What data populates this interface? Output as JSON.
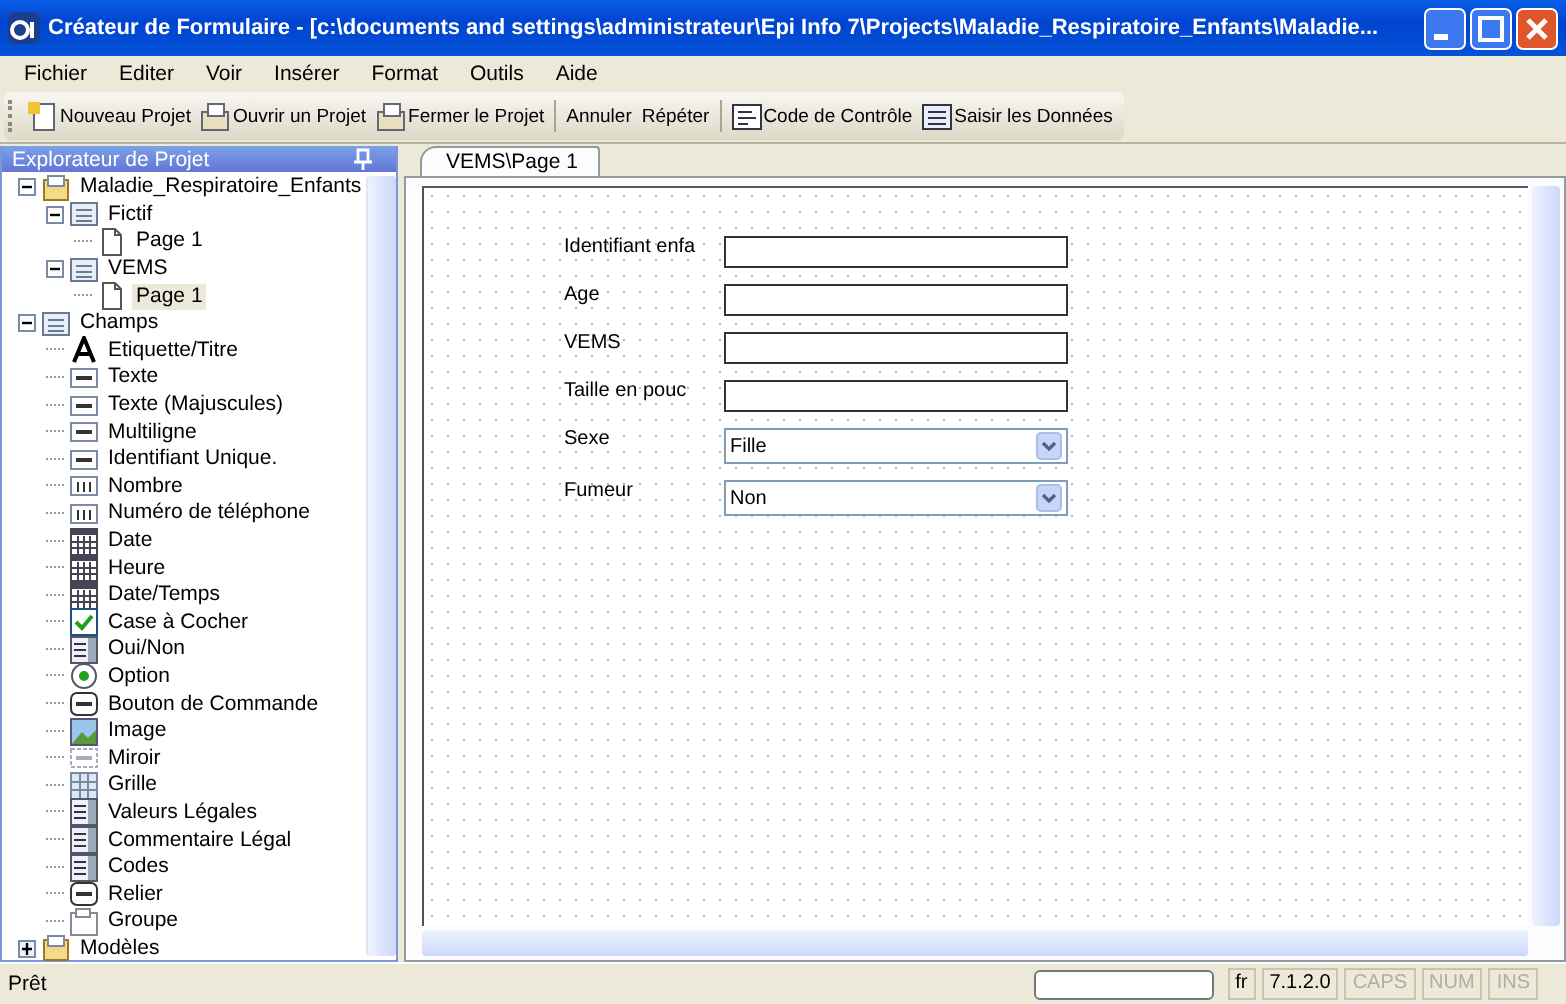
{
  "window": {
    "title": "Créateur de Formulaire - [c:\\documents and settings\\administrateur\\Epi Info 7\\Projects\\Maladie_Respiratoire_Enfants\\Maladie..."
  },
  "menu": [
    "Fichier",
    "Editer",
    "Voir",
    "Insérer",
    "Format",
    "Outils",
    "Aide"
  ],
  "toolbar": [
    {
      "label": "Nouveau Projet",
      "kind": "new"
    },
    {
      "label": "Ouvrir un Projet",
      "kind": "open"
    },
    {
      "label": "Fermer le Projet",
      "kind": "close"
    },
    {
      "label": "Annuler",
      "kind": "plain",
      "separator_before": true
    },
    {
      "label": "Répéter",
      "kind": "plain"
    },
    {
      "label": "Code de Contrôle",
      "kind": "code",
      "separator_before": true
    },
    {
      "label": "Saisir les Données",
      "kind": "data"
    }
  ],
  "sidebar": {
    "title": "Explorateur de Projet",
    "items": [
      {
        "label": "Maladie_Respiratoire_Enfants",
        "kind": "project",
        "expanded": true,
        "selected": false,
        "children": [
          {
            "label": "Fictif",
            "kind": "form",
            "expanded": true,
            "selected": false,
            "children": [
              {
                "label": "Page 1",
                "kind": "page",
                "selected": false
              }
            ]
          },
          {
            "label": "VEMS",
            "kind": "form",
            "expanded": true,
            "selected": false,
            "children": [
              {
                "label": "Page 1",
                "kind": "page",
                "selected": true
              }
            ]
          }
        ]
      },
      {
        "label": "Champs",
        "kind": "form",
        "expanded": true,
        "selected": false,
        "children": [
          {
            "label": "Etiquette/Titre",
            "kind": "label",
            "selected": false
          },
          {
            "label": "Texte",
            "kind": "textbox",
            "selected": false
          },
          {
            "label": "Texte (Majuscules)",
            "kind": "textbox",
            "selected": false
          },
          {
            "label": "Multiligne",
            "kind": "textbox",
            "selected": false
          },
          {
            "label": "Identifiant Unique.",
            "kind": "textbox",
            "selected": false
          },
          {
            "label": "Nombre",
            "kind": "number",
            "selected": false
          },
          {
            "label": "Numéro de téléphone",
            "kind": "number",
            "selected": false
          },
          {
            "label": "Date",
            "kind": "date",
            "selected": false
          },
          {
            "label": "Heure",
            "kind": "date",
            "selected": false
          },
          {
            "label": "Date/Temps",
            "kind": "date",
            "selected": false
          },
          {
            "label": "Case à Cocher",
            "kind": "checkbox",
            "selected": false
          },
          {
            "label": "Oui/Non",
            "kind": "list",
            "selected": false
          },
          {
            "label": "Option",
            "kind": "radio",
            "selected": false
          },
          {
            "label": "Bouton de Commande",
            "kind": "button",
            "selected": false
          },
          {
            "label": "Image",
            "kind": "image",
            "selected": false
          },
          {
            "label": "Miroir",
            "kind": "mirror",
            "selected": false
          },
          {
            "label": "Grille",
            "kind": "grid",
            "selected": false
          },
          {
            "label": "Valeurs Légales",
            "kind": "list",
            "selected": false
          },
          {
            "label": "Commentaire Légal",
            "kind": "list",
            "selected": false
          },
          {
            "label": "Codes",
            "kind": "list",
            "selected": false
          },
          {
            "label": "Relier",
            "kind": "button",
            "selected": false
          },
          {
            "label": "Groupe",
            "kind": "group",
            "selected": false
          }
        ]
      },
      {
        "label": "Modèles",
        "kind": "project",
        "expanded": false,
        "selected": false
      }
    ]
  },
  "tabs": [
    {
      "label": "VEMS\\Page 1",
      "selected": true
    }
  ],
  "form_fields": [
    {
      "label": "Identifiant enfa",
      "kind": "text"
    },
    {
      "label": "Age",
      "kind": "text"
    },
    {
      "label": "VEMS",
      "kind": "text"
    },
    {
      "label": "Taille en pouc",
      "kind": "text"
    },
    {
      "label": "Sexe",
      "kind": "dropdown",
      "value": "Fille"
    },
    {
      "label": "Fumeur",
      "kind": "dropdown",
      "value": "Non"
    }
  ],
  "status_bar": {
    "message": "Prêt",
    "language": "fr",
    "version": "7.1.2.0",
    "indicators": [
      {
        "label": "CAPS",
        "disabled": true
      },
      {
        "label": "NUM",
        "disabled": true
      },
      {
        "label": "INS",
        "disabled": true
      }
    ]
  }
}
